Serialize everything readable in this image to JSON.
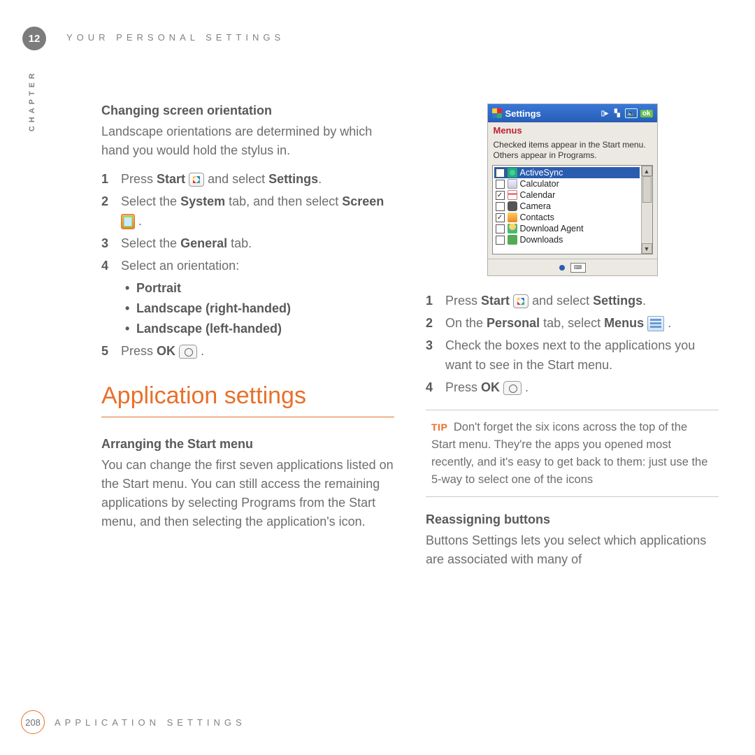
{
  "chapter_number": "12",
  "chapter_label": "CHAPTER",
  "header_title": "YOUR PERSONAL SETTINGS",
  "section1": {
    "heading": "Changing screen orientation",
    "intro": "Landscape orientations are determined by which hand you would hold the stylus in.",
    "steps": {
      "s1a": "Press ",
      "s1b": "Start",
      "s1c": " and select ",
      "s1d": "Settings",
      "s1e": ".",
      "s2a": "Select the ",
      "s2b": "System",
      "s2c": " tab, and then select ",
      "s2d": "Screen",
      "s2e": ".",
      "s3a": "Select the ",
      "s3b": "General",
      "s3c": " tab.",
      "s4": "Select an orientation:",
      "bullets": {
        "b1": "Portrait",
        "b2": "Landscape (right-handed)",
        "b3": "Landscape (left-handed)"
      },
      "s5a": "Press ",
      "s5b": "OK",
      "s5c": "."
    }
  },
  "main_heading": "Application settings",
  "section2": {
    "heading": "Arranging the Start menu",
    "intro": "You can change the first seven applications listed on the Start menu. You can still access the remaining applications by selecting Programs from the Start menu, and then selecting the application's icon."
  },
  "screenshot": {
    "title": "Settings",
    "ok": "ok",
    "subtitle": "Menus",
    "note": "Checked items appear in the Start menu. Others appear in Programs.",
    "items": [
      {
        "label": "ActiveSync",
        "checked": false,
        "selected": true,
        "icon": "ic-sync"
      },
      {
        "label": "Calculator",
        "checked": false,
        "selected": false,
        "icon": "ic-calc"
      },
      {
        "label": "Calendar",
        "checked": true,
        "selected": false,
        "icon": "ic-cal"
      },
      {
        "label": "Camera",
        "checked": false,
        "selected": false,
        "icon": "ic-cam"
      },
      {
        "label": "Contacts",
        "checked": true,
        "selected": false,
        "icon": "ic-con"
      },
      {
        "label": "Download Agent",
        "checked": false,
        "selected": false,
        "icon": "ic-dl"
      },
      {
        "label": "Downloads",
        "checked": false,
        "selected": false,
        "icon": "ic-dls"
      }
    ]
  },
  "section3": {
    "steps": {
      "s1a": "Press ",
      "s1b": "Start",
      "s1c": " and select ",
      "s1d": "Settings",
      "s1e": ".",
      "s2a": "On the ",
      "s2b": "Personal",
      "s2c": " tab, select ",
      "s2d": "Menus",
      "s2e": ".",
      "s3": "Check the boxes next to the applications you want to see in the Start menu.",
      "s4a": "Press ",
      "s4b": "OK",
      "s4c": "."
    }
  },
  "tip": {
    "label": "TIP",
    "text": "Don't forget the six icons across the top of the Start menu. They're the apps you opened most recently, and it's easy to get back to them: just use the 5-way to select one of the icons"
  },
  "section4": {
    "heading": "Reassigning buttons",
    "intro": "Buttons Settings lets you select which applications are associated with many of"
  },
  "footer": {
    "page": "208",
    "title": "APPLICATION SETTINGS"
  }
}
